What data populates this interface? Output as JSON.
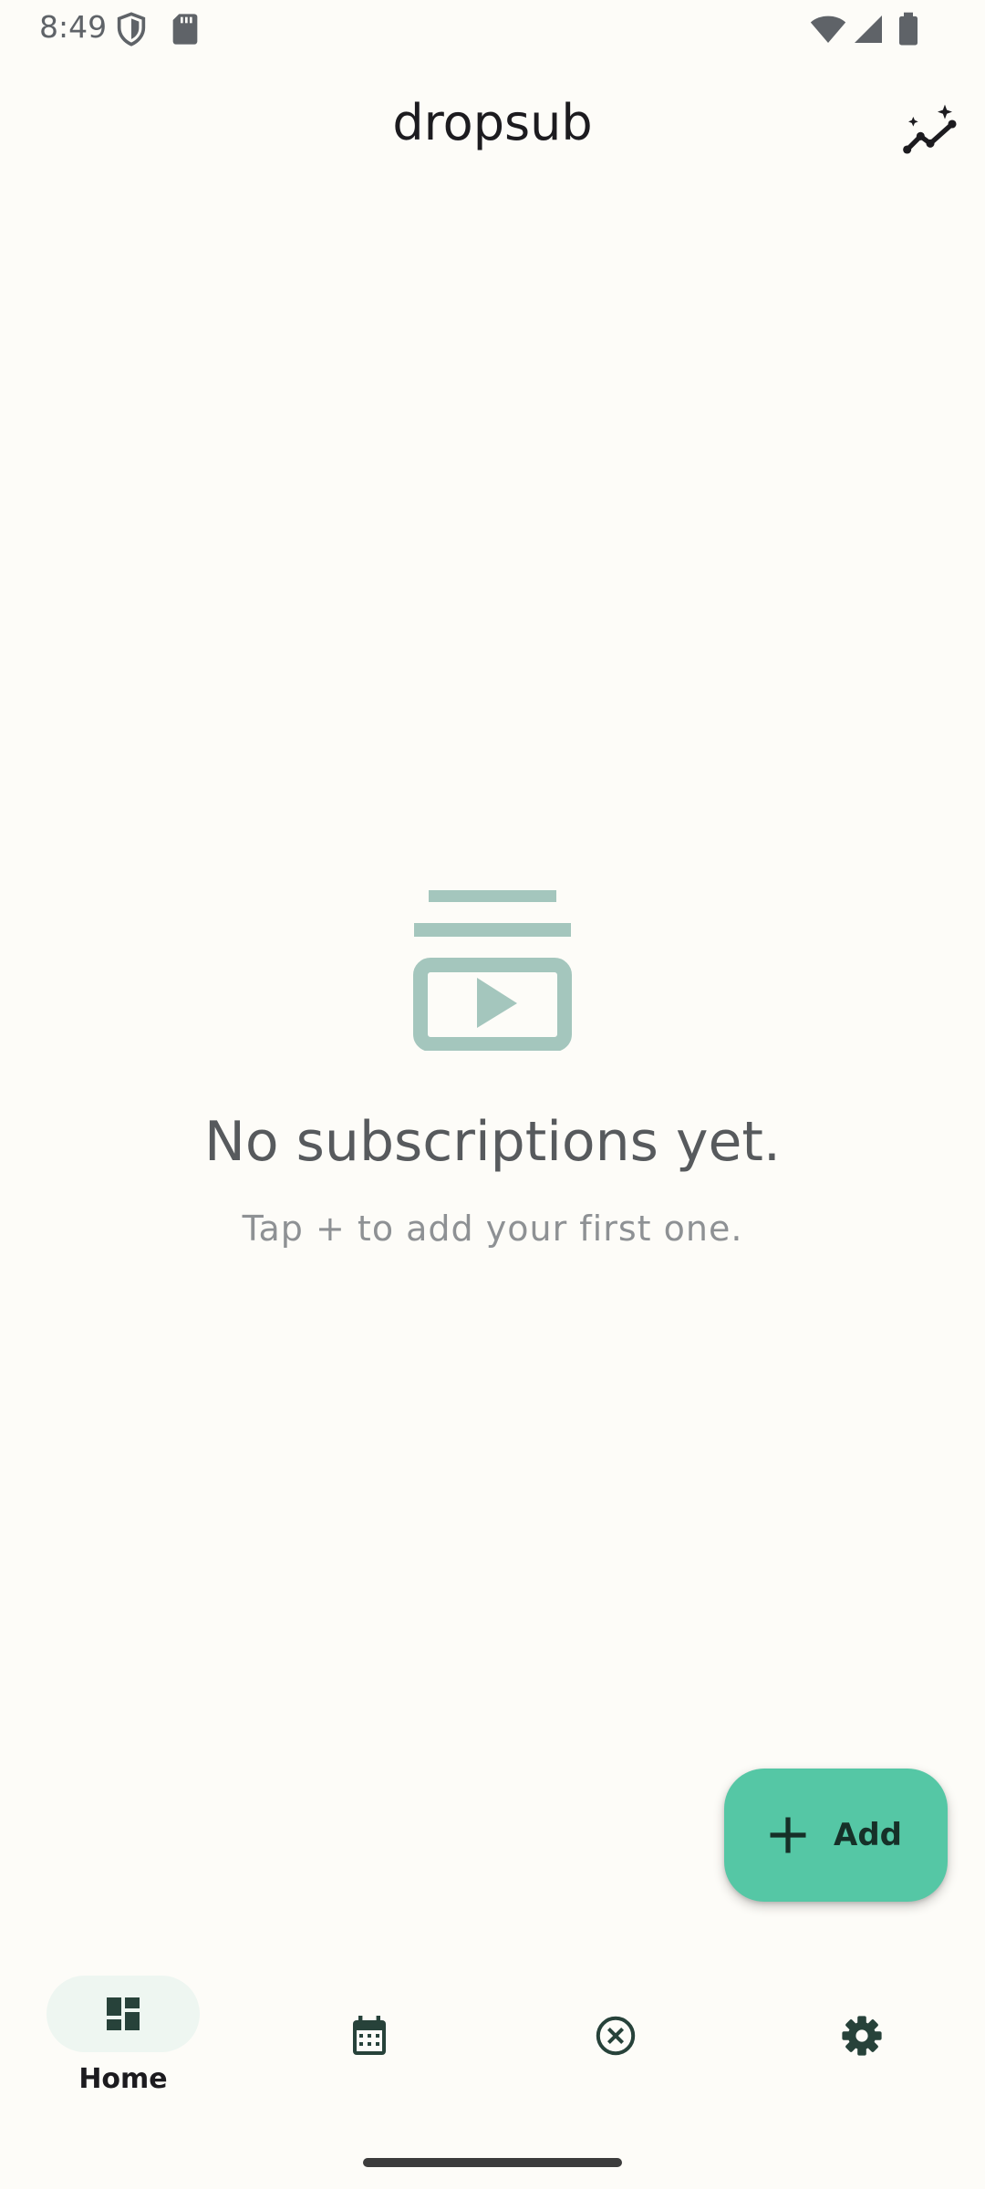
{
  "status_bar": {
    "time": "8:49",
    "icons": [
      "shield-icon",
      "sd-card-icon",
      "wifi-icon",
      "cellular-signal-icon",
      "battery-icon"
    ]
  },
  "app_bar": {
    "title": "dropsub",
    "action_icon": "insights-icon"
  },
  "empty_state": {
    "icon": "subscriptions-icon",
    "title": "No subscriptions yet.",
    "subtitle": "Tap + to add your first one."
  },
  "fab": {
    "icon": "add-icon",
    "label": "Add"
  },
  "bottom_nav": {
    "items": [
      {
        "icon": "dashboard-icon",
        "label": "Home",
        "selected": true
      },
      {
        "icon": "calendar-icon",
        "label": "",
        "selected": false
      },
      {
        "icon": "cancel-circle-icon",
        "label": "",
        "selected": false
      },
      {
        "icon": "settings-icon",
        "label": "",
        "selected": false
      }
    ]
  },
  "colors": {
    "background": "#FDFCF8",
    "accent": "#55C7A5",
    "empty_icon": "#A4C6BD",
    "nav_indicator": "#EEF6F1",
    "nav_icon": "#27423A"
  }
}
